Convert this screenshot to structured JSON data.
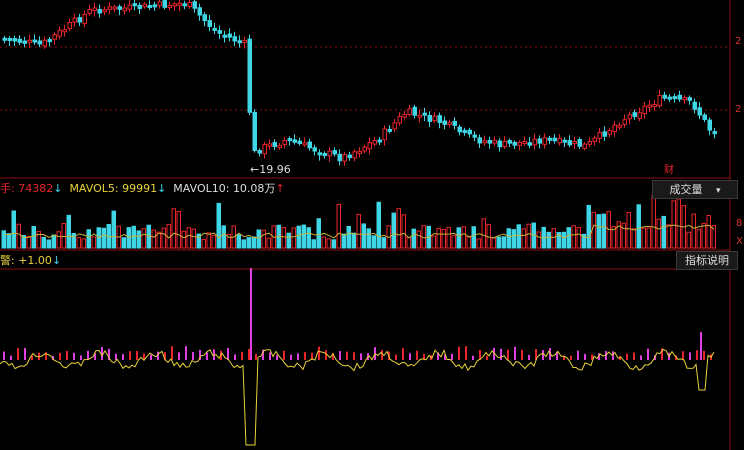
{
  "colors": {
    "up": "#e8252b",
    "down": "#3fd6e6",
    "ma": "#c8b43a",
    "grid": "#8a1010",
    "osc_line": "#e8d23a",
    "osc_bar": "#e040e0",
    "axis": "#e03030"
  },
  "price_pane": {
    "low_label": "19.96",
    "event_badge": "财",
    "axis_numbers": [
      "2",
      "2"
    ]
  },
  "volume_pane": {
    "title_prefix": "手:",
    "vol_value": "74382",
    "mavol5_label": "MAVOL5:",
    "mavol5_value": "99991",
    "mavol10_label": "MAVOL10:",
    "mavol10_value": "10.08万",
    "indicator_button": "成交量",
    "axis_numbers": [
      "8",
      "X"
    ]
  },
  "osc_pane": {
    "title_prefix": "警:",
    "value": "+1.00",
    "help_button": "指标说明"
  },
  "arrows": {
    "down": "↓",
    "up": "↑",
    "dropdown": "▾"
  }
}
